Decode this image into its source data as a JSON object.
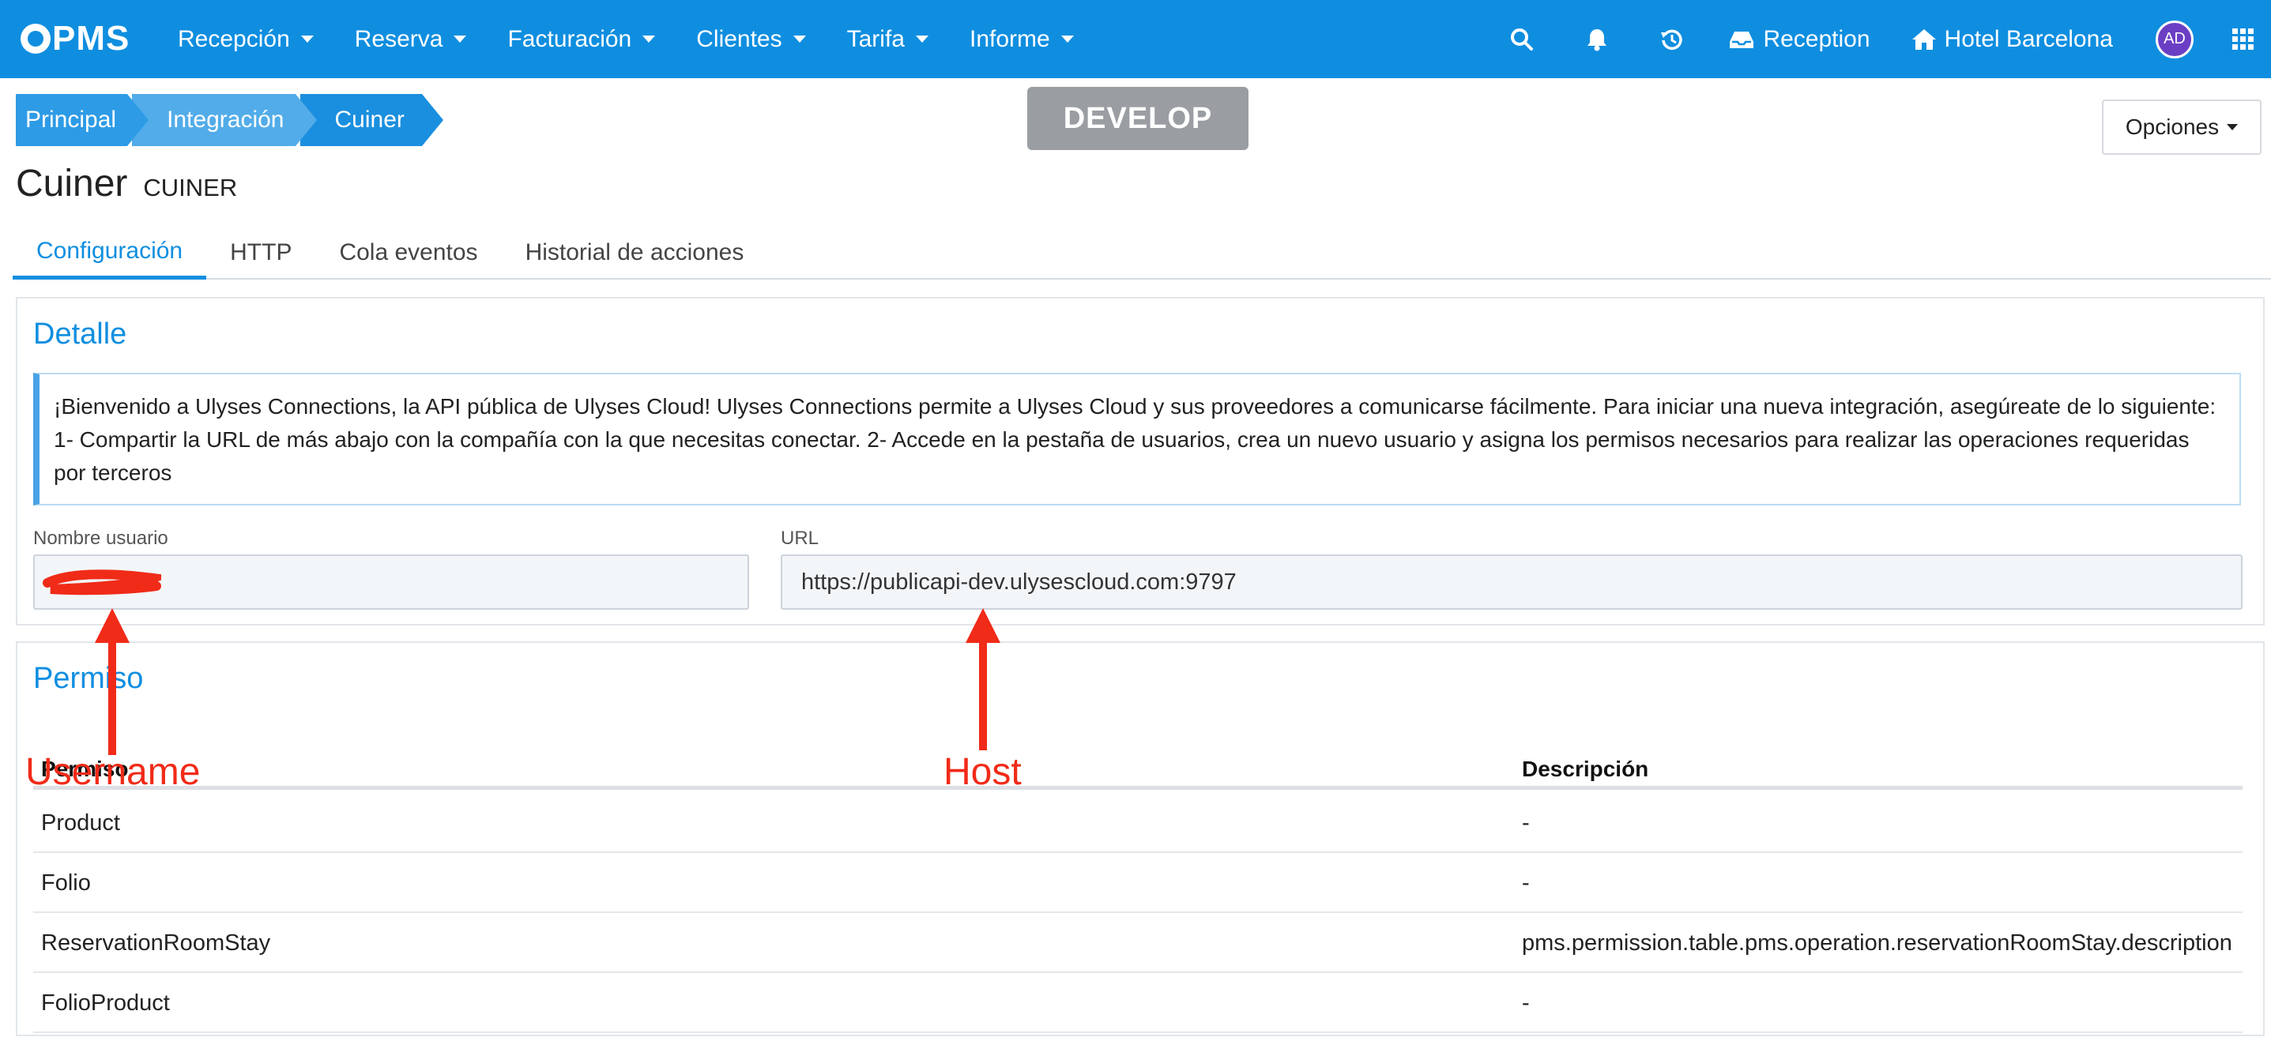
{
  "navbar": {
    "logo_text": "PMS",
    "menu": [
      {
        "label": "Recepción"
      },
      {
        "label": "Reserva"
      },
      {
        "label": "Facturación"
      },
      {
        "label": "Clientes"
      },
      {
        "label": "Tarifa"
      },
      {
        "label": "Informe"
      }
    ],
    "right": {
      "search_icon": "search-icon",
      "bell_icon": "bell-icon",
      "history_icon": "history-icon",
      "reception_label": "Reception",
      "hotel_label": "Hotel Barcelona",
      "avatar_initials": "AD",
      "apps_icon": "grid-icon"
    },
    "colors": {
      "background": "#0f8ee0"
    }
  },
  "breadcrumb": [
    "Principal",
    "Integración",
    "Cuiner"
  ],
  "env_badge": "DEVELOP",
  "options_button": "Opciones",
  "page": {
    "title": "Cuiner",
    "subtitle": "CUINER"
  },
  "tabs": [
    {
      "label": "Configuración",
      "active": true
    },
    {
      "label": "HTTP",
      "active": false
    },
    {
      "label": "Cola eventos",
      "active": false
    },
    {
      "label": "Historial de acciones",
      "active": false
    }
  ],
  "detail": {
    "title": "Detalle",
    "info": "¡Bienvenido a Ulyses Connections, la API pública de Ulyses Cloud! Ulyses Connections permite a Ulyses Cloud y sus proveedores a comunicarse fácilmente. Para iniciar una nueva integración, asegúreate de lo siguiente: 1- Compartir la URL de más abajo con la compañía con la que necesitas conectar. 2- Accede en la pestaña de usuarios, crea un nuevo usuario y asigna los permisos necesarios para realizar las operaciones requeridas por terceros",
    "username_label": "Nombre usuario",
    "username_value": "",
    "url_label": "URL",
    "url_value": "https://publicapi-dev.ulysescloud.com:9797"
  },
  "permissions": {
    "title": "Permiso",
    "columns": [
      "Permiso",
      "Descripción"
    ],
    "rows": [
      {
        "permission": "Product",
        "description": "-"
      },
      {
        "permission": "Folio",
        "description": "-"
      },
      {
        "permission": "ReservationRoomStay",
        "description": "pms.permission.table.pms.operation.reservationRoomStay.description"
      },
      {
        "permission": "FolioProduct",
        "description": "-"
      }
    ]
  },
  "annotations": {
    "username": "Username",
    "host": "Host",
    "color": "#f02b18"
  }
}
